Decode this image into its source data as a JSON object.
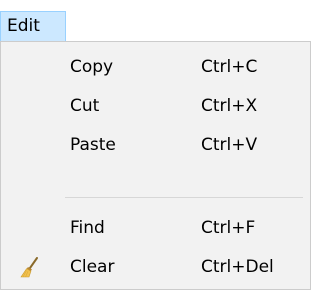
{
  "menubar": {
    "edit_label": "Edit"
  },
  "menu": {
    "copy": {
      "label": "Copy",
      "shortcut": "Ctrl+C"
    },
    "cut": {
      "label": "Cut",
      "shortcut": "Ctrl+X"
    },
    "paste": {
      "label": "Paste",
      "shortcut": "Ctrl+V"
    },
    "find": {
      "label": "Find",
      "shortcut": "Ctrl+F"
    },
    "clear": {
      "label": "Clear",
      "shortcut": "Ctrl+Del",
      "icon": "broom-icon"
    }
  }
}
